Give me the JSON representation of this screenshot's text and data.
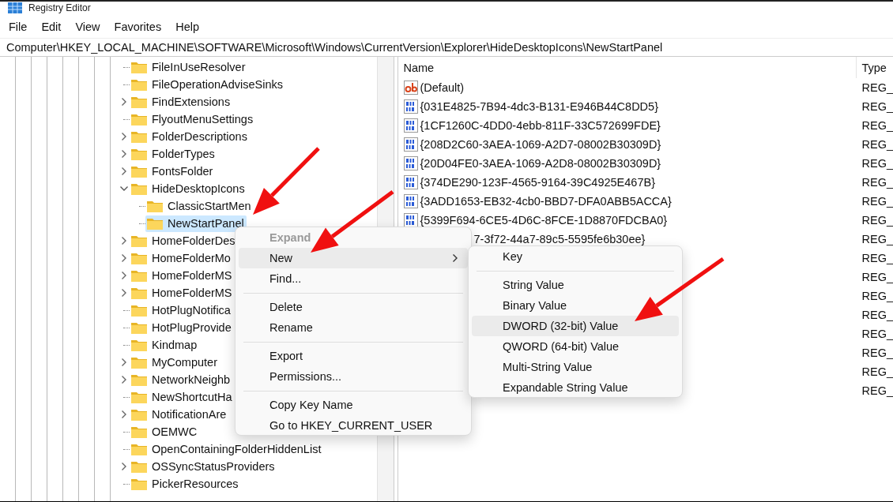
{
  "window": {
    "title": "Registry Editor"
  },
  "menu_bar": [
    "File",
    "Edit",
    "View",
    "Favorites",
    "Help"
  ],
  "address": "Computer\\HKEY_LOCAL_MACHINE\\SOFTWARE\\Microsoft\\Windows\\CurrentVersion\\Explorer\\HideDesktopIcons\\NewStartPanel",
  "tree": {
    "items": [
      {
        "kind": "leaf",
        "name": "FileInUseResolver",
        "selected": false
      },
      {
        "kind": "leaf",
        "name": "FileOperationAdviseSinks",
        "selected": false
      },
      {
        "kind": "collapsed",
        "name": "FindExtensions",
        "selected": false
      },
      {
        "kind": "leaf",
        "name": "FlyoutMenuSettings",
        "selected": false
      },
      {
        "kind": "collapsed",
        "name": "FolderDescriptions",
        "selected": false
      },
      {
        "kind": "collapsed",
        "name": "FolderTypes",
        "selected": false
      },
      {
        "kind": "collapsed",
        "name": "FontsFolder",
        "selected": false
      },
      {
        "kind": "expanded",
        "name": "HideDesktopIcons",
        "selected": false,
        "children": [
          {
            "kind": "leaf",
            "name": "ClassicStartMen",
            "selected": false
          },
          {
            "kind": "leaf",
            "name": "NewStartPanel",
            "selected": true
          }
        ]
      },
      {
        "kind": "collapsed",
        "name": "HomeFolderDes",
        "selected": false
      },
      {
        "kind": "collapsed",
        "name": "HomeFolderMo",
        "selected": false
      },
      {
        "kind": "collapsed",
        "name": "HomeFolderMS",
        "selected": false
      },
      {
        "kind": "collapsed",
        "name": "HomeFolderMS",
        "selected": false
      },
      {
        "kind": "leaf",
        "name": "HotPlugNotifica",
        "selected": false
      },
      {
        "kind": "leaf",
        "name": "HotPlugProvide",
        "selected": false
      },
      {
        "kind": "leaf",
        "name": "Kindmap",
        "selected": false
      },
      {
        "kind": "collapsed",
        "name": "MyComputer",
        "selected": false
      },
      {
        "kind": "collapsed",
        "name": "NetworkNeighb",
        "selected": false
      },
      {
        "kind": "leaf",
        "name": "NewShortcutHa",
        "selected": false
      },
      {
        "kind": "collapsed",
        "name": "NotificationAre",
        "selected": false
      },
      {
        "kind": "leaf",
        "name": "OEMWC",
        "selected": false
      },
      {
        "kind": "leaf",
        "name": "OpenContainingFolderHiddenList",
        "selected": false
      },
      {
        "kind": "collapsed",
        "name": "OSSyncStatusProviders",
        "selected": false
      },
      {
        "kind": "leaf",
        "name": "PickerResources",
        "selected": false
      }
    ]
  },
  "values": {
    "columns": [
      "Name",
      "Type"
    ],
    "rows": [
      {
        "kind": "string_value",
        "name": "(Default)",
        "type": "REG_"
      },
      {
        "kind": "binary_value",
        "name": "{031E4825-7B94-4dc3-B131-E946B44C8DD5}",
        "type": "REG_"
      },
      {
        "kind": "binary_value",
        "name": "{1CF1260C-4DD0-4ebb-811F-33C572699FDE}",
        "type": "REG_"
      },
      {
        "kind": "binary_value",
        "name": "{208D2C60-3AEA-1069-A2D7-08002B30309D}",
        "type": "REG_"
      },
      {
        "kind": "binary_value",
        "name": "{20D04FE0-3AEA-1069-A2D8-08002B30309D}",
        "type": "REG_"
      },
      {
        "kind": "binary_value",
        "name": "{374DE290-123F-4565-9164-39C4925E467B}",
        "type": "REG_"
      },
      {
        "kind": "binary_value",
        "name": "{3ADD1653-EB32-4cb0-BBD7-DFA0ABB5ACCA}",
        "type": "REG_"
      },
      {
        "kind": "binary_value",
        "name": "{5399F694-6CE5-4D6C-8FCE-1D8870FDCBA0}",
        "type": "REG_"
      },
      {
        "kind": "covered",
        "name": "7-3f72-44a7-89c5-5595fe6b30ee}",
        "type": "REG_"
      },
      {
        "kind": "type_only",
        "type": "REG_"
      },
      {
        "kind": "type_only",
        "type": "REG_"
      },
      {
        "kind": "type_only",
        "type": "REG_"
      },
      {
        "kind": "type_only",
        "type": "REG_"
      },
      {
        "kind": "type_only",
        "type": "REG_"
      },
      {
        "kind": "type_only",
        "type": "REG_"
      },
      {
        "kind": "type_only",
        "type": "REG_"
      },
      {
        "kind": "type_only",
        "type": "REG_"
      }
    ]
  },
  "context_menu": {
    "items": [
      {
        "kind": "item",
        "label": "Expand",
        "disabled": true,
        "selected": false,
        "submenu": false
      },
      {
        "kind": "item",
        "label": "New",
        "disabled": false,
        "selected": true,
        "submenu": true
      },
      {
        "kind": "item",
        "label": "Find...",
        "disabled": false,
        "selected": false,
        "submenu": false
      },
      {
        "kind": "separator"
      },
      {
        "kind": "item",
        "label": "Delete",
        "disabled": false,
        "selected": false,
        "submenu": false
      },
      {
        "kind": "item",
        "label": "Rename",
        "disabled": false,
        "selected": false,
        "submenu": false
      },
      {
        "kind": "separator"
      },
      {
        "kind": "item",
        "label": "Export",
        "disabled": false,
        "selected": false,
        "submenu": false
      },
      {
        "kind": "item",
        "label": "Permissions...",
        "disabled": false,
        "selected": false,
        "submenu": false
      },
      {
        "kind": "separator"
      },
      {
        "kind": "item",
        "label": "Copy Key Name",
        "disabled": false,
        "selected": false,
        "submenu": false
      },
      {
        "kind": "item",
        "label": "Go to HKEY_CURRENT_USER",
        "disabled": false,
        "selected": false,
        "submenu": false
      }
    ]
  },
  "submenu": {
    "items": [
      {
        "kind": "item",
        "label": "Key",
        "disabled": false,
        "selected": false,
        "submenu": false
      },
      {
        "kind": "separator"
      },
      {
        "kind": "item",
        "label": "String Value",
        "disabled": false,
        "selected": false,
        "submenu": false
      },
      {
        "kind": "item",
        "label": "Binary Value",
        "disabled": false,
        "selected": false,
        "submenu": false
      },
      {
        "kind": "item",
        "label": "DWORD (32-bit) Value",
        "disabled": false,
        "selected": true,
        "submenu": false
      },
      {
        "kind": "item",
        "label": "QWORD (64-bit) Value",
        "disabled": false,
        "selected": false,
        "submenu": false
      },
      {
        "kind": "item",
        "label": "Multi-String Value",
        "disabled": false,
        "selected": false,
        "submenu": false
      },
      {
        "kind": "item",
        "label": "Expandable String Value",
        "disabled": false,
        "selected": false,
        "submenu": false
      }
    ]
  }
}
